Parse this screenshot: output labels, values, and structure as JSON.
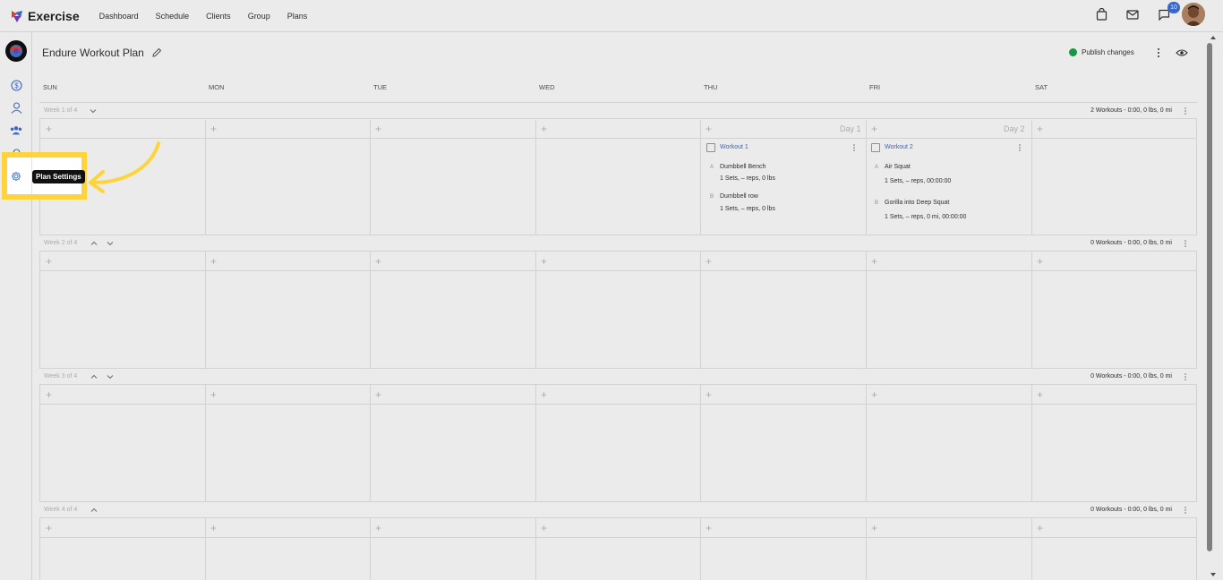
{
  "app": {
    "name": "Exercise"
  },
  "nav": [
    "Dashboard",
    "Schedule",
    "Clients",
    "Group",
    "Plans"
  ],
  "header": {
    "notification_count": "10"
  },
  "plan": {
    "title": "Endure Workout Plan",
    "publish_label": "Publish changes"
  },
  "days": [
    "SUN",
    "MON",
    "TUE",
    "WED",
    "THU",
    "FRI",
    "SAT"
  ],
  "weeks": [
    {
      "label": "Week 1 of 4",
      "summary": "2 Workouts - 0:00, 0 lbs, 0 mi"
    },
    {
      "label": "Week 2 of 4",
      "summary": "0 Workouts - 0:00, 0 lbs, 0 mi"
    },
    {
      "label": "Week 3 of 4",
      "summary": "0 Workouts - 0:00, 0 lbs, 0 mi"
    },
    {
      "label": "Week 4 of 4",
      "summary": "0 Workouts - 0:00, 0 lbs, 0 mi"
    }
  ],
  "day_tags": {
    "thu": "Day 1",
    "fri": "Day 2"
  },
  "workouts": [
    {
      "title": "Workout 1",
      "exercises": [
        {
          "letter": "A",
          "name": "Dumbbell Bench",
          "detail": "1 Sets, – reps, 0 lbs"
        },
        {
          "letter": "B",
          "name": "Dumbbell row",
          "detail": "1 Sets, – reps, 0 lbs"
        }
      ]
    },
    {
      "title": "Workout 2",
      "exercises": [
        {
          "letter": "A",
          "name": "Air Squat",
          "detail": "1 Sets, – reps, 00:00:00"
        },
        {
          "letter": "B",
          "name": "Gorilla into Deep Squat",
          "detail": "1 Sets, – reps, 0 mi, 00:00:00"
        }
      ]
    }
  ],
  "tooltip": {
    "label": "Plan Settings"
  },
  "colors": {
    "accent": "#3f6fd6",
    "publish": "#1aa34a",
    "highlight": "#ffd43b"
  },
  "icons": {
    "top": [
      "bag-icon",
      "mail-icon",
      "chat-icon",
      "avatar"
    ],
    "rail": [
      "dollar-icon",
      "user-icon",
      "group-icon",
      "bell-icon",
      "gear-icon"
    ]
  }
}
